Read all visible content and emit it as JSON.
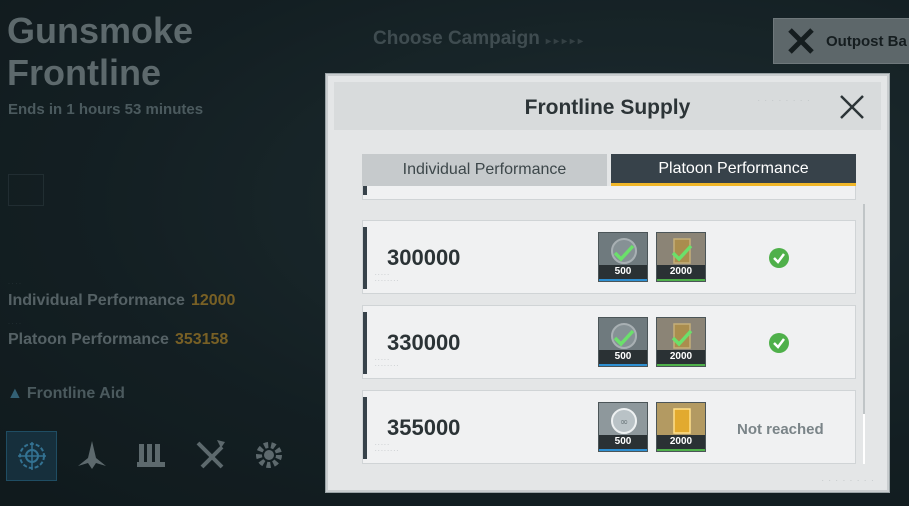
{
  "event": {
    "title_line1": "Gunsmoke",
    "title_line2": "Frontline",
    "ends": "Ends in 1 hours 53 minutes"
  },
  "stats": {
    "individual_label": "Individual Performance",
    "individual_value": "12000",
    "platoon_label": "Platoon Performance",
    "platoon_value": "353158"
  },
  "aid": {
    "title": "Frontline Aid",
    "icons": [
      "target-icon",
      "jet-icon",
      "barricade-icon",
      "crossed-missiles-icon",
      "gear-wrench-icon"
    ]
  },
  "campaign": {
    "title": "Choose Campaign",
    "dots": "▸▸▸▸▸"
  },
  "outpost": {
    "label": "Outpost Ba"
  },
  "modal": {
    "title": "Frontline Supply",
    "tabs": [
      {
        "label": "Individual Performance",
        "active": false
      },
      {
        "label": "Platoon Performance",
        "active": true
      }
    ],
    "rows": [
      {
        "score": "300000",
        "rewards": [
          {
            "qty": "500",
            "type": "silver-medal",
            "claimed": true
          },
          {
            "qty": "2000",
            "type": "gold-bar",
            "claimed": true
          }
        ],
        "status": "claimed"
      },
      {
        "score": "330000",
        "rewards": [
          {
            "qty": "500",
            "type": "silver-medal",
            "claimed": true
          },
          {
            "qty": "2000",
            "type": "gold-bar",
            "claimed": true
          }
        ],
        "status": "claimed"
      },
      {
        "score": "355000",
        "rewards": [
          {
            "qty": "500",
            "type": "silver-medal",
            "claimed": false
          },
          {
            "qty": "2000",
            "type": "gold-bar",
            "claimed": false
          }
        ],
        "status_text": "Not reached"
      }
    ]
  },
  "colors": {
    "accent_gold": "#f0b628",
    "value_gold": "#b48a2e",
    "check_green": "#4fb04a",
    "tab_dark": "#37424a"
  }
}
